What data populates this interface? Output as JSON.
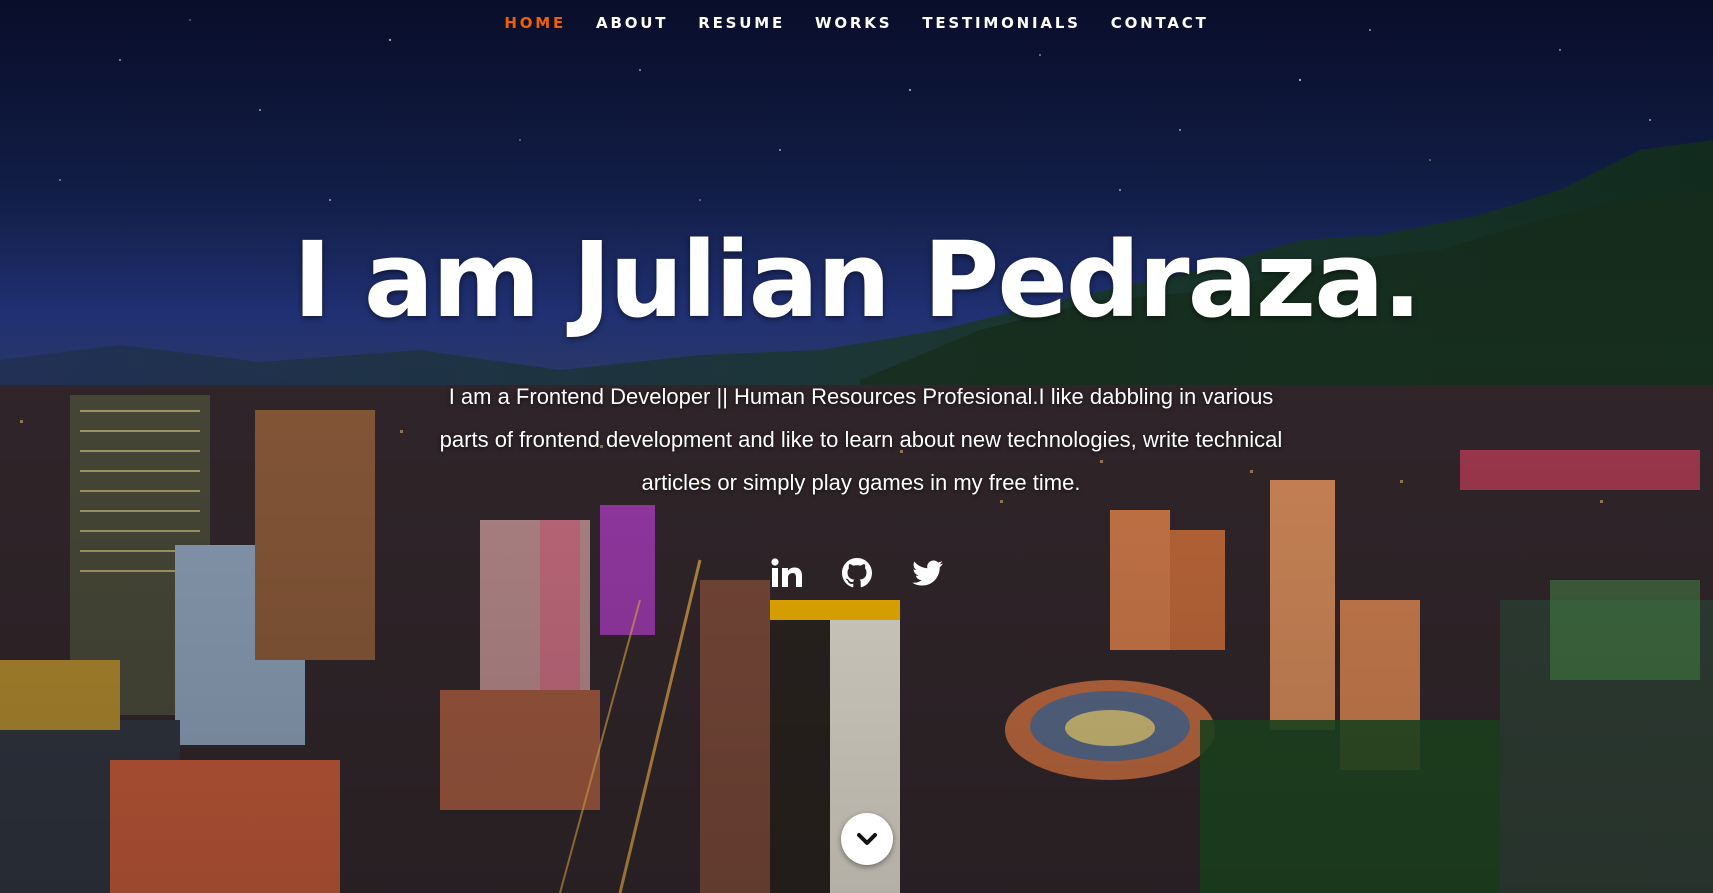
{
  "nav": {
    "items": [
      {
        "label": "HOME",
        "active": true
      },
      {
        "label": "ABOUT",
        "active": false
      },
      {
        "label": "RESUME",
        "active": false
      },
      {
        "label": "WORKS",
        "active": false
      },
      {
        "label": "TESTIMONIALS",
        "active": false
      },
      {
        "label": "CONTACT",
        "active": false
      }
    ],
    "active_color": "#f06000"
  },
  "hero": {
    "headline": "I am Julian Pedraza.",
    "intro": "I am a Frontend Developer || Human Resources Profesional.I like dabbling in various parts of frontend development and like to learn about new technologies, write technical articles or simply play games in my free time.",
    "background": "night-city-skyline"
  },
  "social": {
    "icons": [
      "linkedin-icon",
      "github-icon",
      "twitter-icon"
    ]
  },
  "scroll_button": {
    "icon": "chevron-down-icon"
  }
}
